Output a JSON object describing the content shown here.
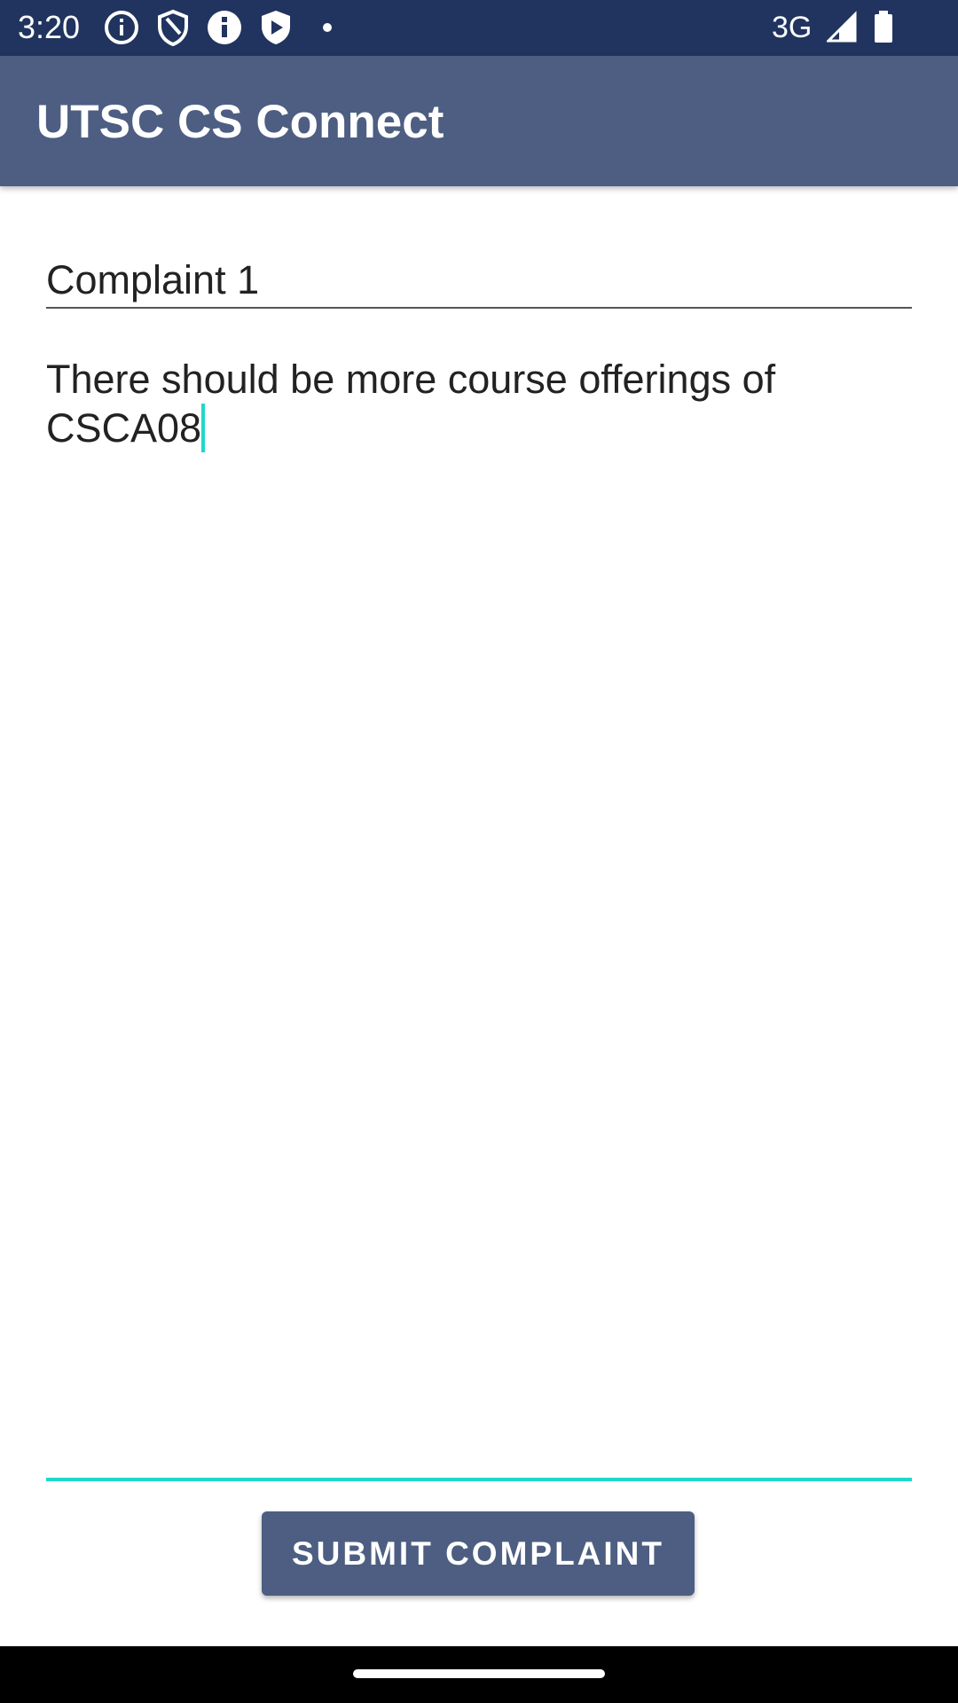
{
  "status_bar": {
    "time": "3:20",
    "network": "3G",
    "left_icons": [
      "info-circle-icon",
      "shield-icon",
      "info-filled-icon",
      "play-shield-icon",
      "dot-icon"
    ],
    "right_icons": [
      "signal-icon",
      "battery-icon"
    ],
    "background_color": "#20345f"
  },
  "app_bar": {
    "title": "UTSC CS Connect",
    "background_color": "#4d5e82"
  },
  "form": {
    "title_value": "Complaint 1",
    "body_value": "There should be more course offerings of CSCA08",
    "accent_color": "#1fd8c9"
  },
  "submit_button": {
    "label": "SUBMIT COMPLAINT"
  }
}
